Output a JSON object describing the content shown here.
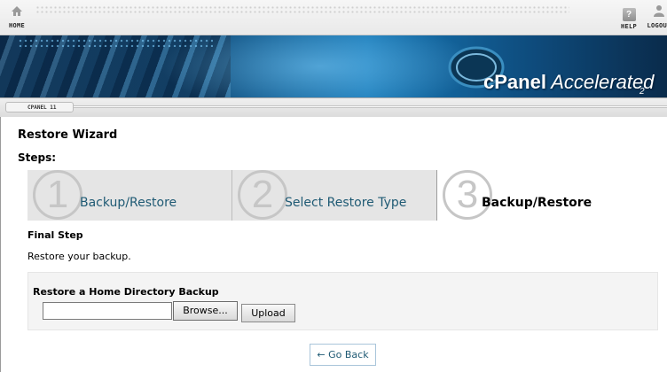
{
  "topbar": {
    "home_label": "HOME",
    "help_label": "HELP",
    "logout_label": "LOGOUT",
    "help_icon_glyph": "?",
    "icons": [
      "home-icon",
      "help-icon",
      "user-icon"
    ]
  },
  "banner": {
    "brand_cpanel": "cPanel",
    "brand_accelerated": "Accelerated",
    "brand_version": "2",
    "colors": {
      "primary": "#1778b6",
      "dark": "#0c2a4a"
    }
  },
  "breadcrumb": {
    "label": "CPANEL 11"
  },
  "main": {
    "title": "Restore Wizard",
    "steps_label": "Steps:",
    "steps": [
      {
        "number": "1",
        "label": "Backup/Restore",
        "state": "done"
      },
      {
        "number": "2",
        "label": "Select Restore Type",
        "state": "done"
      },
      {
        "number": "3",
        "label": "Backup/Restore",
        "state": "current"
      }
    ],
    "final_step_title": "Final Step",
    "final_step_desc": "Restore your backup.",
    "restore_panel": {
      "title": "Restore a Home Directory Backup",
      "file_value": "",
      "browse_label": "Browse...",
      "upload_label": "Upload"
    },
    "go_back_label": "← Go Back",
    "colors": {
      "step_text": "#1f5a74",
      "panel_bg": "#f4f4f4"
    }
  }
}
